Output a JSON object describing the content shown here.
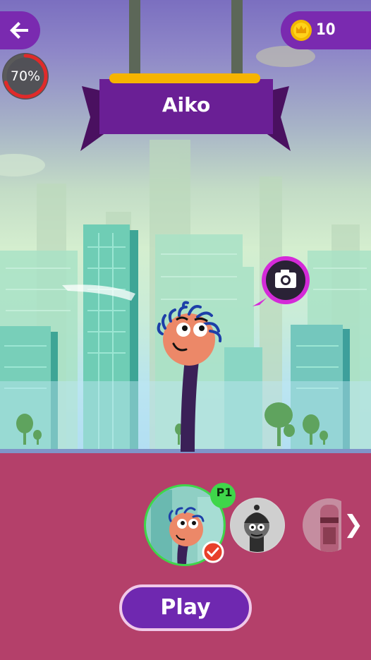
{
  "header": {
    "back_icon": "arrow-left-icon",
    "progress_value": 0.7,
    "progress_text": "70%",
    "coin_icon": "crown-coin-icon",
    "coins": "10"
  },
  "character": {
    "name": "Aiko",
    "camera_icon": "camera-icon"
  },
  "selector": {
    "selected_badge": "P1",
    "check_icon": "checkmark-icon",
    "next_icon": "chevron-right-icon",
    "next_glyph": "❯"
  },
  "actions": {
    "play_label": "Play"
  },
  "colors": {
    "purple": "#7a2ab0",
    "bottom_panel": "#b4406a",
    "selected_ring": "#3fd64a",
    "progress_ring": "#e02a2a",
    "camera_bubble": "#d42ad8",
    "ribbon_gold": "#f6b400"
  }
}
